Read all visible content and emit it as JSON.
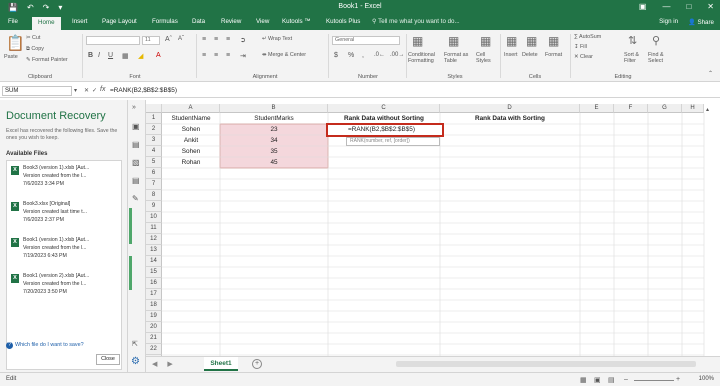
{
  "window": {
    "title": "Book1 - Excel"
  },
  "ribbon_tabs": [
    "File",
    "Home",
    "Insert",
    "Page Layout",
    "Formulas",
    "Data",
    "Review",
    "View",
    "Kutools ™",
    "Kutools Plus"
  ],
  "active_tab": "Home",
  "tell_me": "Tell me what you want to do...",
  "account": {
    "signin": "Sign in",
    "share": "Share"
  },
  "ribbon": {
    "clipboard": {
      "paste": "Paste",
      "cut": "Cut",
      "copy": "Copy",
      "format_painter": "Format Painter",
      "label": "Clipboard"
    },
    "font": {
      "size": "11",
      "bold": "B",
      "italic": "I",
      "underline": "U",
      "label": "Font"
    },
    "alignment": {
      "wrap": "Wrap Text",
      "merge": "Merge & Center",
      "label": "Alignment"
    },
    "number": {
      "format": "General",
      "currency": "$",
      "percent": "%",
      "comma": ",",
      "label": "Number"
    },
    "styles": {
      "conditional": "Conditional Formatting",
      "format_table": "Format as Table",
      "cell_styles": "Cell Styles",
      "label": "Styles"
    },
    "cells": {
      "insert": "Insert",
      "delete": "Delete",
      "format": "Format",
      "label": "Cells"
    },
    "editing": {
      "autosum": "AutoSum",
      "fill": "Fill",
      "clear": "Clear",
      "sort_filter": "Sort & Filter",
      "find_select": "Find & Select",
      "label": "Editing"
    }
  },
  "formula_bar": {
    "name_box": "SUM",
    "fx": "fx",
    "formula": "=RANK(B2,$B$2:$B$5)"
  },
  "recovery": {
    "title": "Document Recovery",
    "description": "Excel has recovered the following files. Save the ones you wish to keep.",
    "available_files": "Available Files",
    "files": [
      {
        "name": "Book3 (version 1).xlsb  [Aut...",
        "status": "Version created from the l...",
        "date": "7/6/2023 3:34 PM"
      },
      {
        "name": "Book3.xlsx  [Original]",
        "status": "Version created last time t...",
        "date": "7/6/2023 2:37 PM"
      },
      {
        "name": "Book1 (version 1).xlsb  [Aut...",
        "status": "Version created from the l...",
        "date": "7/19/2023 6:43 PM"
      },
      {
        "name": "Book1 (version 2).xlsb  [Aut...",
        "status": "Version created from the l...",
        "date": "7/20/2023 3:50 PM"
      }
    ],
    "help": "Which file do I want to save?",
    "close": "Close"
  },
  "grid": {
    "columns": [
      "A",
      "B",
      "C",
      "D",
      "E",
      "F",
      "G",
      "H"
    ],
    "rows": [
      "1",
      "2",
      "3",
      "4",
      "5",
      "6",
      "7",
      "8",
      "9",
      "10",
      "11",
      "12",
      "13",
      "14",
      "15",
      "16",
      "17",
      "18",
      "19",
      "20",
      "21",
      "22",
      "23"
    ],
    "headers": {
      "a1": "StudentName",
      "b1": "StudentMarks",
      "c1": "Rank Data without Sorting",
      "d1": "Rank Data with Sorting"
    },
    "data": [
      {
        "name": "Sohen",
        "marks": "23"
      },
      {
        "name": "Ankit",
        "marks": "34"
      },
      {
        "name": "Sohen",
        "marks": "35"
      },
      {
        "name": "Rohan",
        "marks": "45"
      }
    ],
    "editing_cell": "=RANK(B2,$B$2:$B$5)",
    "tooltip": "RANK(number, ref, [order])"
  },
  "sheet_tabs": [
    "Sheet1"
  ],
  "status": {
    "mode": "Edit",
    "zoom": "100%"
  },
  "colors": {
    "accent": "#217346",
    "selection": "#f4d7dc",
    "edit_border": "#c42b1c"
  }
}
